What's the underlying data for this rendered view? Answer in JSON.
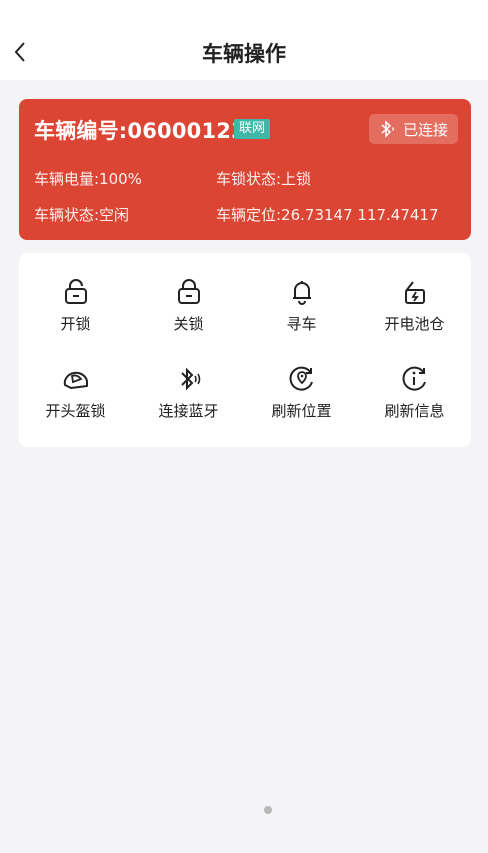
{
  "header": {
    "title": "车辆操作"
  },
  "vehicle": {
    "id_label": "车辆编号:06000123",
    "network_badge": "联网",
    "bluetooth_status": "已连接",
    "battery": "车辆电量:100%",
    "lock_status": "车锁状态:上锁",
    "vehicle_status": "车辆状态:空闲",
    "location": "车辆定位:26.73147 117.47417"
  },
  "operations": {
    "unlock": "开锁",
    "lock": "关锁",
    "find_vehicle": "寻车",
    "open_battery": "开电池仓",
    "open_helmet_lock": "开头盔锁",
    "connect_bluetooth": "连接蓝牙",
    "refresh_location": "刷新位置",
    "refresh_info": "刷新信息"
  },
  "colors": {
    "card_red": "#dc4533",
    "badge_teal": "#3fb8a8"
  }
}
